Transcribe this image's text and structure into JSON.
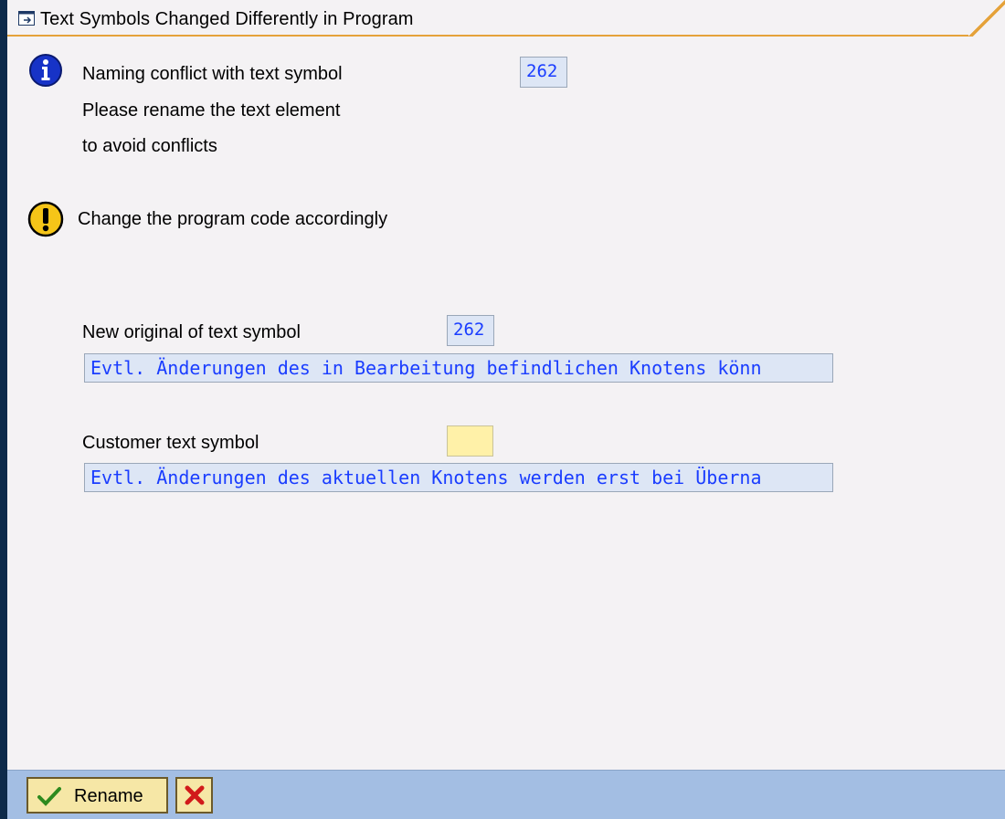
{
  "window": {
    "title": "Text Symbols Changed Differently in Program"
  },
  "info_message": {
    "line1": "Naming conflict with text symbol",
    "line2": "Please rename the text element",
    "line3": "to avoid conflicts",
    "symbol_number": "262"
  },
  "warning_message": {
    "text": "Change the program code accordingly"
  },
  "new_original": {
    "label": "New original of text symbol",
    "symbol_number": "262",
    "text": "Evtl. Änderungen des in Bearbeitung befindlichen Knotens könn"
  },
  "customer_symbol": {
    "label": "Customer text symbol",
    "symbol_value": "",
    "text": "Evtl. Änderungen des aktuellen Knotens werden erst bei Überna"
  },
  "footer": {
    "rename_label": "Rename"
  },
  "icons": {
    "title": "dialog-window-icon",
    "close": "close-icon",
    "info": "info-icon",
    "warning": "warning-icon",
    "rename": "checkmark-icon",
    "cancel": "cancel-x-icon"
  },
  "colors": {
    "field_text": "#1a3dff",
    "field_bg": "#dde6f5",
    "input_bg": "#fff1a8",
    "footer_bg": "#a3bee3",
    "title_accent": "#e5a23a"
  }
}
